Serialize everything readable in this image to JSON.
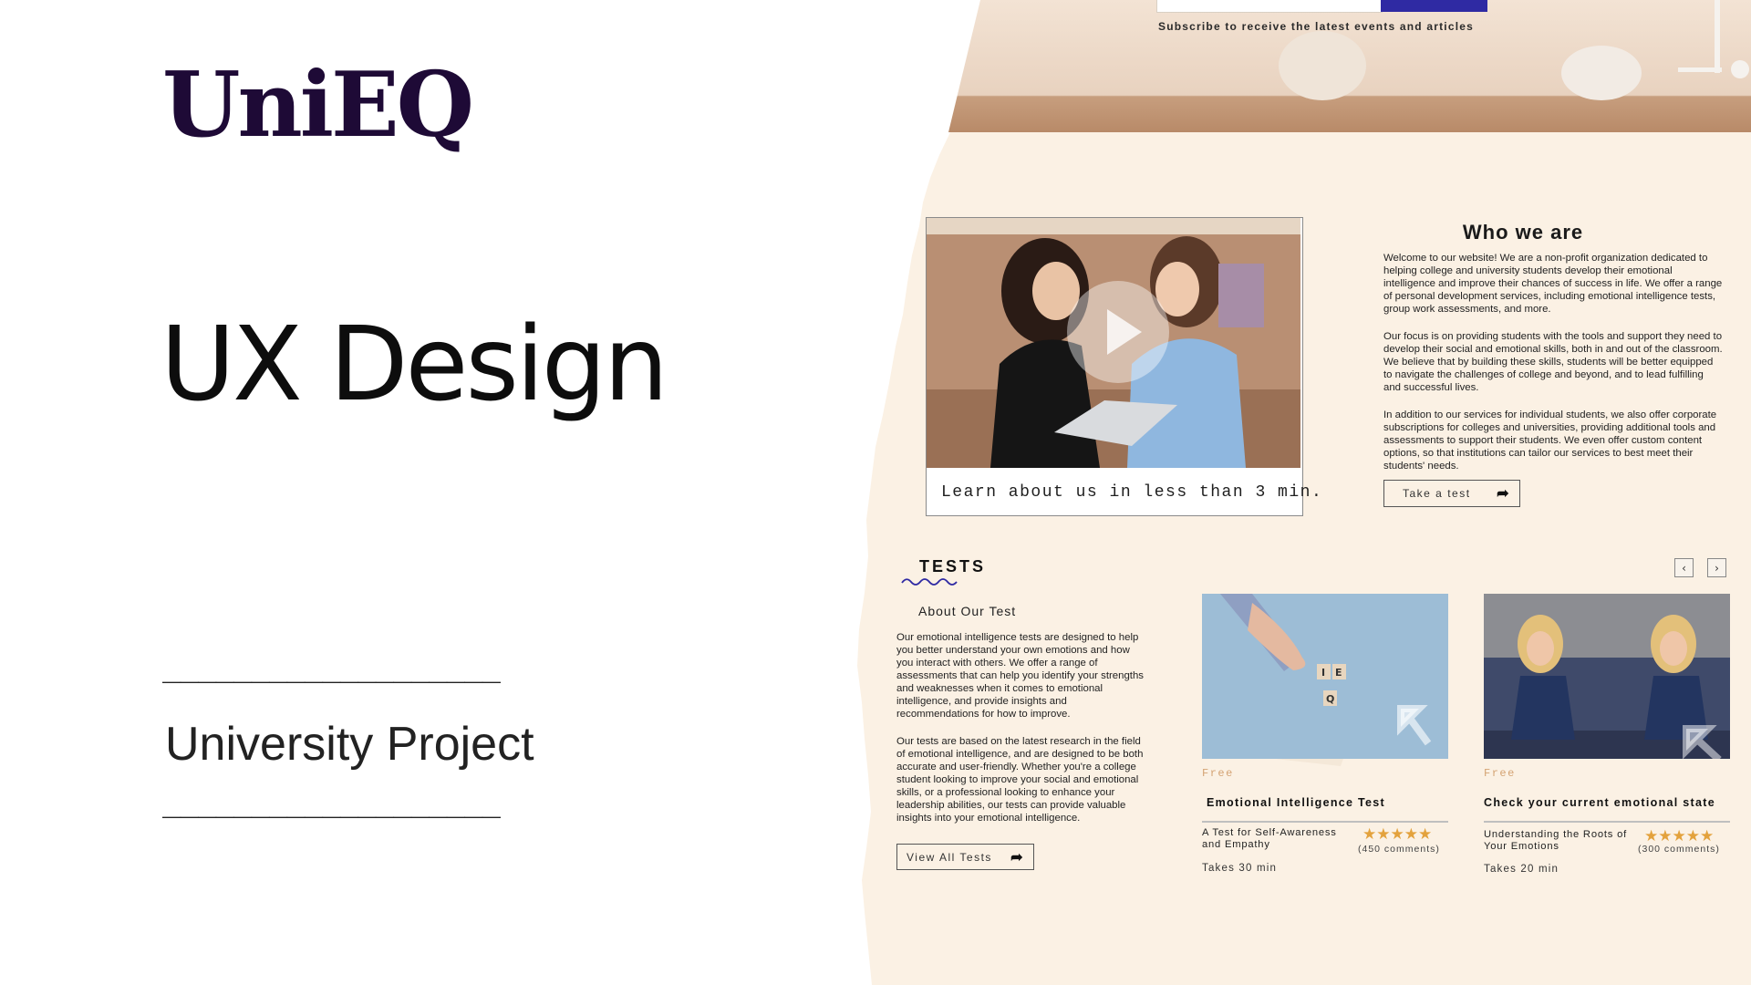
{
  "slide": {
    "logo": "UniEQ",
    "headline": "UX Design",
    "dash_line": "___________________",
    "subtitle": "University Project"
  },
  "mockup": {
    "subscribe_text": "Subscribe to receive the latest events and articles",
    "about": {
      "caption": "Learn about us in less than 3 min.",
      "title": "Who we are",
      "paragraphs": [
        "Welcome to our website! We are a non-profit organization dedicated to helping college and university students develop their emotional intelligence and improve their chances of success in life. We offer a range of personal development services, including emotional intelligence tests, group work assessments, and more.",
        "Our focus is on providing students with the tools and support they need to develop their social and emotional skills, both in and out of the classroom. We believe that by building these skills, students will be better equipped to navigate the challenges of college and beyond, and to lead fulfilling and successful lives.",
        "In addition to our services for individual students, we also offer corporate subscriptions for colleges and universities, providing additional tools and assessments to support their students. We even offer custom content options, so that institutions can tailor our services to best meet their students' needs."
      ],
      "button_label": "Take a test"
    },
    "tests": {
      "title": "TESTS",
      "about_label": "About Our Test",
      "paragraphs": [
        "Our emotional intelligence tests are designed to help you better understand your own emotions and how you interact with others. We offer a range of assessments that can help you identify your strengths and weaknesses when it comes to emotional intelligence, and provide insights and recommendations for how to improve.",
        "Our tests are based on the latest research in the field of emotional intelligence, and are designed to be both accurate and user-friendly. Whether you're a college student looking to improve your social and emotional skills, or a professional looking to enhance your leadership abilities, our tests can provide valuable insights into your emotional intelligence."
      ],
      "view_all_label": "View All Tests",
      "prev_label": "‹",
      "next_label": "›",
      "cards": [
        {
          "badge": "Free",
          "title": "Emotional Intelligence Test",
          "subtitle": "A Test for Self-Awareness and Empathy",
          "stars": "★★★★★",
          "rating": 5,
          "comments": "(450 comments)",
          "duration": "Takes 30 min",
          "tile_letters": [
            "I",
            "E",
            "Q"
          ]
        },
        {
          "badge": "Free",
          "title": "Check your current emotional state",
          "subtitle": "Understanding the Roots of Your Emotions",
          "stars": "★★★★★",
          "rating": 5,
          "comments": "(300 comments)",
          "duration": "Takes 20 min"
        }
      ]
    }
  },
  "colors": {
    "logo": "#1e0a36",
    "paper": "#fbf1e4",
    "paper_shade": "#f4e8d8",
    "accent_blue": "#2f2aa3",
    "star": "#e3a23d",
    "free": "#d4a373"
  }
}
